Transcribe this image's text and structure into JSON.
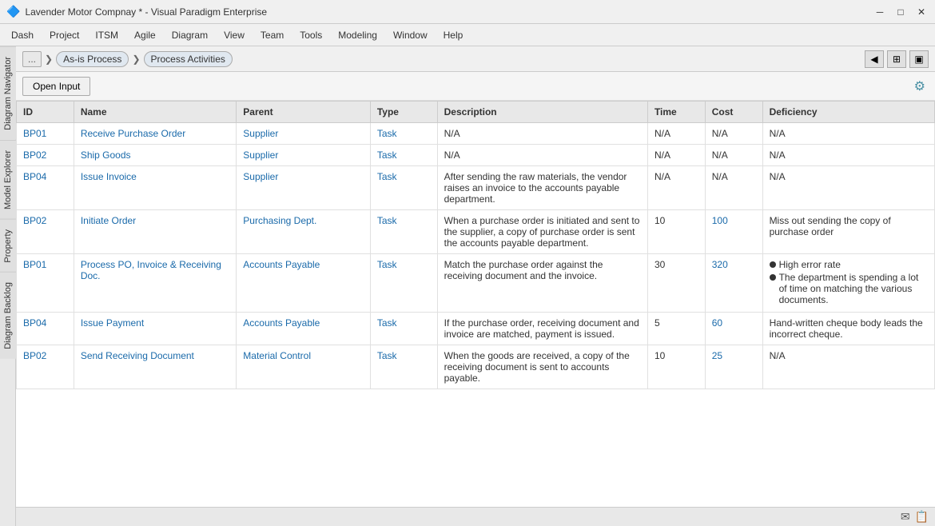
{
  "titleBar": {
    "icon": "🔷",
    "text": "Lavender Motor Compnay * - Visual Paradigm Enterprise",
    "controls": {
      "minimize": "─",
      "maximize": "□",
      "close": "✕"
    }
  },
  "menuBar": {
    "items": [
      "Dash",
      "Project",
      "ITSM",
      "Agile",
      "Diagram",
      "View",
      "Team",
      "Tools",
      "Modeling",
      "Window",
      "Help"
    ]
  },
  "breadcrumb": {
    "dots": "...",
    "items": [
      "As-is Process",
      "Process Activities"
    ]
  },
  "toolbar": {
    "openInputLabel": "Open Input"
  },
  "sidebarTabs": [
    "Diagram Navigator",
    "Model Explorer",
    "Property",
    "Diagram Backlog"
  ],
  "table": {
    "columns": [
      "ID",
      "Name",
      "Parent",
      "Type",
      "Description",
      "Time",
      "Cost",
      "Deficiency"
    ],
    "rows": [
      {
        "id": "BP01",
        "name": "Receive Purchase Order",
        "parent": "Supplier",
        "type": "Task",
        "description": "N/A",
        "time": "N/A",
        "cost": "N/A",
        "deficiency": "N/A",
        "deficiency_bullets": []
      },
      {
        "id": "BP02",
        "name": "Ship Goods",
        "parent": "Supplier",
        "type": "Task",
        "description": "N/A",
        "time": "N/A",
        "cost": "N/A",
        "deficiency": "N/A",
        "deficiency_bullets": []
      },
      {
        "id": "BP04",
        "name": "Issue Invoice",
        "parent": "Supplier",
        "type": "Task",
        "description": "After sending the raw materials, the vendor raises an invoice to the accounts payable department.",
        "time": "N/A",
        "cost": "N/A",
        "deficiency": "N/A",
        "deficiency_bullets": []
      },
      {
        "id": "BP02",
        "name": "Initiate Order",
        "parent": "Purchasing Dept.",
        "type": "Task",
        "description": "When a purchase order is initiated and sent to the supplier, a copy of purchase order is sent the accounts payable department.",
        "time": "10",
        "cost": "100",
        "deficiency": "Miss out sending the copy of purchase order",
        "deficiency_bullets": []
      },
      {
        "id": "BP01",
        "name": "Process PO, Invoice & Receiving Doc.",
        "parent": "Accounts Payable",
        "type": "Task",
        "description": "Match the purchase order against the receiving document and the invoice.",
        "time": "30",
        "cost": "320",
        "deficiency": "",
        "deficiency_bullets": [
          "High error rate",
          "The department is spending a lot of time on matching the various documents."
        ]
      },
      {
        "id": "BP04",
        "name": "Issue Payment",
        "parent": "Accounts Payable",
        "type": "Task",
        "description": "If the purchase order, receiving document and invoice are matched, payment is issued.",
        "time": "5",
        "cost": "60",
        "deficiency": "Hand-written cheque body leads the incorrect cheque.",
        "deficiency_bullets": []
      },
      {
        "id": "BP02",
        "name": "Send Receiving Document",
        "parent": "Material Control",
        "type": "Task",
        "description": "When the goods are received, a copy of the receiving document is sent to accounts payable.",
        "time": "10",
        "cost": "25",
        "deficiency": "N/A",
        "deficiency_bullets": []
      }
    ]
  },
  "statusBar": {
    "emailIcon": "✉",
    "docIcon": "📄"
  }
}
